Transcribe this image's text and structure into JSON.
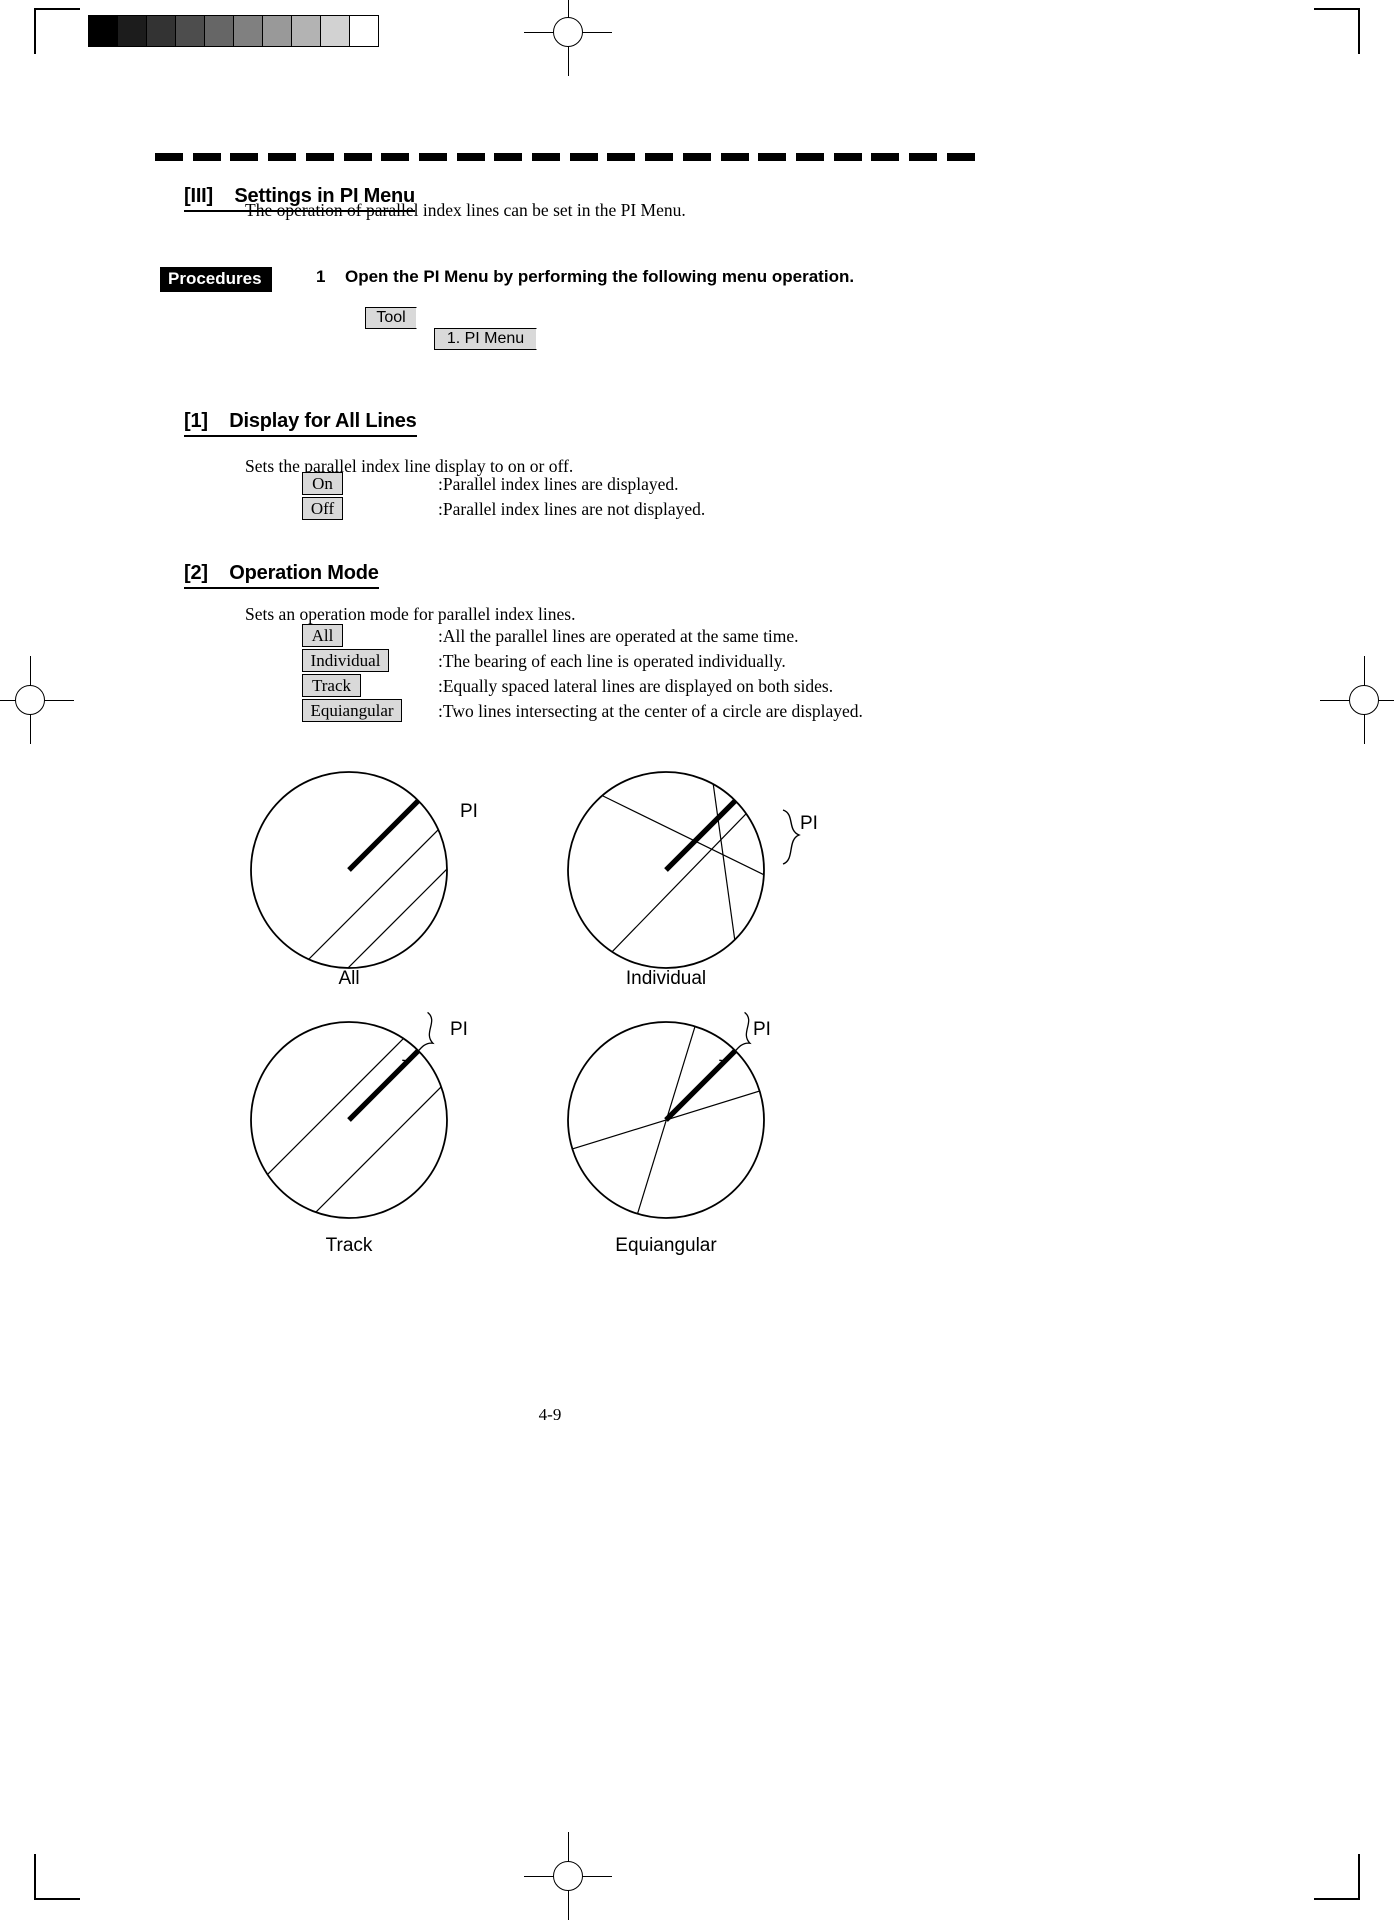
{
  "document": {
    "page_footer": "4-9",
    "section_rule_dashes": 22
  },
  "calibration": {
    "name": "grayscale-step-wedge",
    "steps": [
      "#000000",
      "#1c1c1c",
      "#333333",
      "#4d4d4d",
      "#666666",
      "#808080",
      "#999999",
      "#b3b3b3",
      "#d2d2d2",
      "#ffffff"
    ]
  },
  "headings": {
    "section_3": "[III]    Settings in PI Menu",
    "sub_1": "[1]    Display for All Lines",
    "sub_2": "[2]    Operation Mode"
  },
  "intro": {
    "text": "The operation of parallel index lines can be set in the PI Menu."
  },
  "procedures": {
    "tag_label": "Procedures",
    "step_number": "1",
    "step_text": "Open the PI Menu by performing the following menu operation.",
    "menu_path": [
      {
        "label": "Tool"
      },
      {
        "label": "1. PI Menu"
      }
    ]
  },
  "display_all_lines": {
    "description": "Sets the parallel index line display to on or off.",
    "options": [
      {
        "button": "On",
        "description": ":Parallel index lines are displayed."
      },
      {
        "button": "Off",
        "description": ":Parallel index lines are not displayed."
      }
    ]
  },
  "operation_mode": {
    "description": "Sets an operation mode for parallel index lines.",
    "options": [
      {
        "button": "All",
        "description": ":All the parallel lines are operated at the same time."
      },
      {
        "button": "Individual",
        "description": ":The bearing of each line is operated individually."
      },
      {
        "button": "Track",
        "description": ":Equally spaced lateral lines are displayed on both sides."
      },
      {
        "button": "Equiangular",
        "description": ":Two lines intersecting at the center of a circle are displayed."
      }
    ]
  },
  "figures": [
    {
      "id": "all",
      "caption": "All",
      "pi_label": "PI",
      "has_brace": false
    },
    {
      "id": "individual",
      "caption": "Individual",
      "pi_label": "PI",
      "has_brace": true
    },
    {
      "id": "track",
      "caption": "Track",
      "pi_label": "PI",
      "has_brace": true
    },
    {
      "id": "equiangular",
      "caption": "Equiangular",
      "pi_label": "PI",
      "has_brace": true
    }
  ],
  "colors": {
    "ink": "#000000",
    "paper": "#ffffff",
    "key_face": "#d9d9d9"
  }
}
